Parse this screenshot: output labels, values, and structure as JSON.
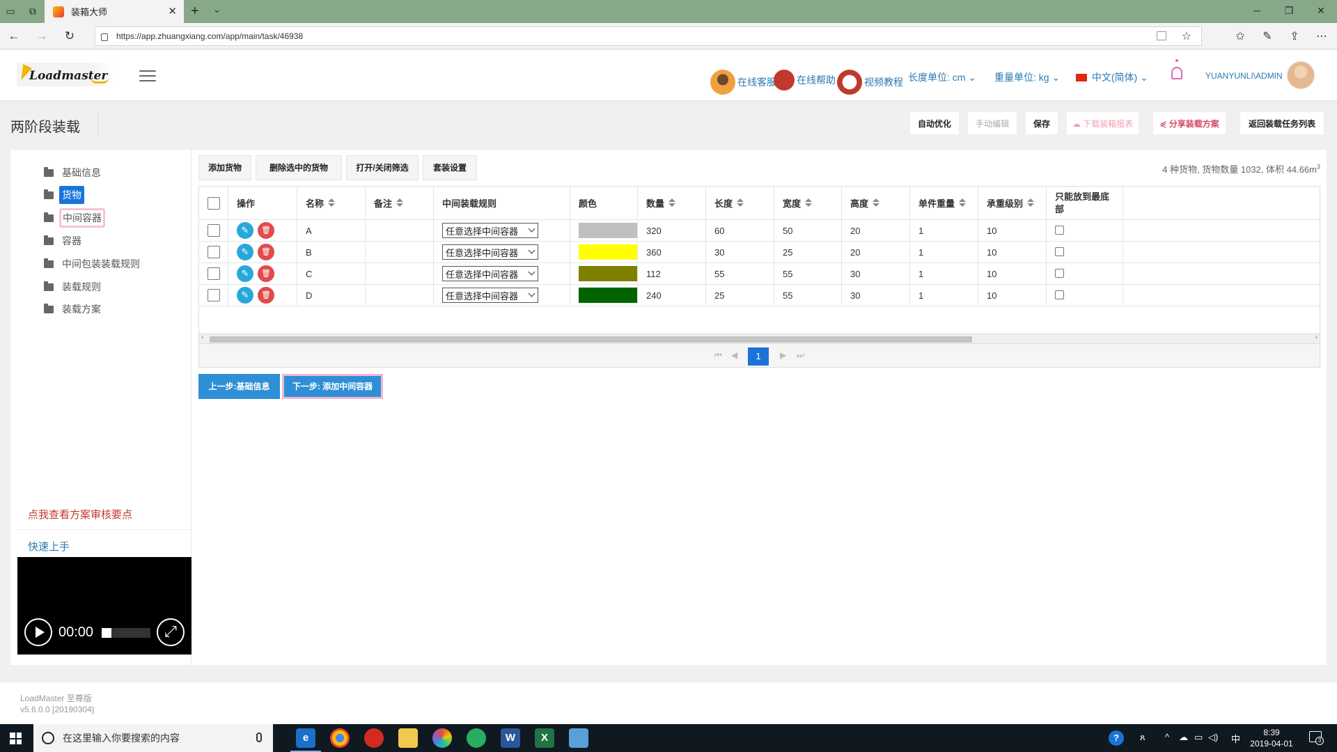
{
  "browser": {
    "tab_title": "装箱大师",
    "url": "https://app.zhuangxiang.com/app/main/task/46938"
  },
  "header": {
    "logo_text": "Loadmaster",
    "links": [
      {
        "label": "在线客服",
        "icon": "customer-service-icon"
      },
      {
        "label": "在线帮助",
        "icon": "help-book-icon"
      },
      {
        "label": "视频教程",
        "icon": "video-tutorial-icon"
      }
    ],
    "length_unit": "长度单位: cm",
    "weight_unit": "重量单位: kg",
    "language": "中文(简体)",
    "username": "YUANYUNLI\\ADMIN"
  },
  "page": {
    "title": "两阶段装载",
    "buttons": {
      "auto_optimize": "自动优化",
      "manual_edit": "手动编辑",
      "save": "保存",
      "download_report": "下载装箱报表",
      "share_plan": "分享装载方案",
      "back_to_list": "返回装载任务列表"
    }
  },
  "sidebar": {
    "items": [
      {
        "label": "基础信息"
      },
      {
        "label": "货物"
      },
      {
        "label": "中间容器"
      },
      {
        "label": "容器"
      },
      {
        "label": "中间包装装载规则"
      },
      {
        "label": "装载规则"
      },
      {
        "label": "装载方案"
      }
    ],
    "review_link": "点我查看方案审核要点",
    "quickstart_link": "快速上手",
    "video_time": "00:00"
  },
  "toolbar": {
    "add_goods": "添加货物",
    "delete_selected": "删除选中的货物",
    "toggle_filter": "打开/关闭筛选",
    "kit_settings": "套装设置",
    "summary": "4 种货物, 货物数量 1032, 体积 44.66m",
    "summary_sup": "3"
  },
  "table": {
    "columns": [
      "操作",
      "名称",
      "备注",
      "中间装载规则",
      "颜色",
      "数量",
      "长度",
      "宽度",
      "高度",
      "单件重量",
      "承重级别",
      "只能放到最底部"
    ],
    "rows": [
      {
        "name": "A",
        "remark": "",
        "rule": "任意选择中间容器",
        "color": "#c0c0c0",
        "qty": "320",
        "length": "60",
        "width": "50",
        "height": "20",
        "weight": "1",
        "load_level": "10"
      },
      {
        "name": "B",
        "remark": "",
        "rule": "任意选择中间容器",
        "color": "#ffff00",
        "qty": "360",
        "length": "30",
        "width": "25",
        "height": "20",
        "weight": "1",
        "load_level": "10"
      },
      {
        "name": "C",
        "remark": "",
        "rule": "任意选择中间容器",
        "color": "#808000",
        "qty": "112",
        "length": "55",
        "width": "55",
        "height": "30",
        "weight": "1",
        "load_level": "10"
      },
      {
        "name": "D",
        "remark": "",
        "rule": "任意选择中间容器",
        "color": "#006400",
        "qty": "240",
        "length": "25",
        "width": "55",
        "height": "30",
        "weight": "1",
        "load_level": "10"
      }
    ]
  },
  "pager": {
    "current_page": "1"
  },
  "steps": {
    "prev": "上一步:基础信息",
    "next": "下一步: 添加中间容器"
  },
  "footer": {
    "product": "LoadMaster 至尊版",
    "version": "v5.6.0.0 [20190304]"
  },
  "taskbar": {
    "search_placeholder": "在这里输入你要搜索的内容",
    "time": "8:39",
    "date": "2019-04-01",
    "ime": "中",
    "notifications": "3"
  }
}
